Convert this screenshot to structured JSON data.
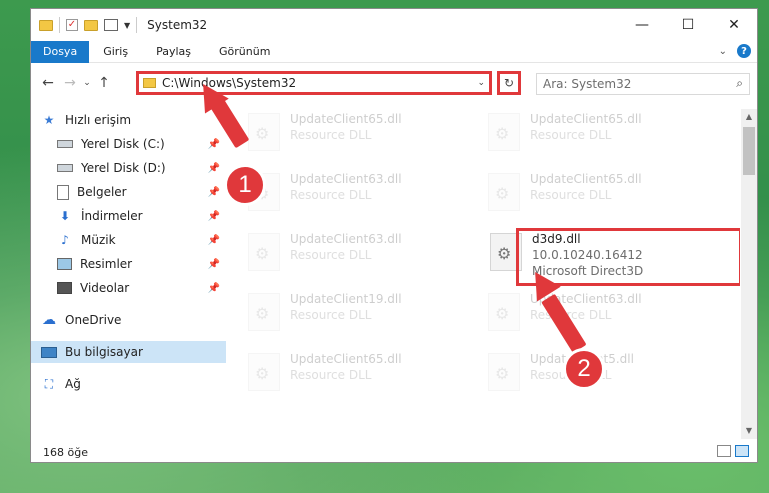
{
  "window": {
    "title": "System32",
    "controls": {
      "minimize": "—",
      "maximize": "☐",
      "close": "✕"
    }
  },
  "ribbon": {
    "tabs": [
      "Dosya",
      "Giriş",
      "Paylaş",
      "Görünüm"
    ],
    "help": "?"
  },
  "navigation": {
    "address_path": "C:\\Windows\\System32",
    "search_placeholder": "Ara: System32"
  },
  "sidebar": {
    "items": [
      {
        "label": "Hızlı erişim",
        "icon": "star-icon"
      },
      {
        "label": "Yerel Disk (C:)",
        "icon": "drive-icon",
        "pinned": true
      },
      {
        "label": "Yerel Disk (D:)",
        "icon": "drive-icon",
        "pinned": true
      },
      {
        "label": "Belgeler",
        "icon": "documents-icon",
        "pinned": true
      },
      {
        "label": "İndirmeler",
        "icon": "download-icon",
        "pinned": true
      },
      {
        "label": "Müzik",
        "icon": "music-icon",
        "pinned": true
      },
      {
        "label": "Resimler",
        "icon": "pictures-icon",
        "pinned": true
      },
      {
        "label": "Videolar",
        "icon": "video-icon",
        "pinned": true
      },
      {
        "label": "OneDrive",
        "icon": "cloud-icon"
      },
      {
        "label": "Bu bilgisayar",
        "icon": "computer-icon",
        "selected": true
      },
      {
        "label": "Ağ",
        "icon": "network-icon"
      }
    ]
  },
  "files": [
    {
      "name": "UpdateClient65.dll",
      "type": "Resource DLL",
      "faded": true
    },
    {
      "name": "UpdateClient65.dll",
      "type": "Resource DLL",
      "faded": true
    },
    {
      "name": "UpdateClient63.dll",
      "type": "Resource DLL",
      "faded": true
    },
    {
      "name": "UpdateClient65.dll",
      "type": "Resource DLL",
      "faded": true
    },
    {
      "name": "UpdateClient63.dll",
      "type": "Resource DLL",
      "faded": true
    },
    {
      "name": "d3d9.dll",
      "version": "10.0.10240.16412",
      "type": "Microsoft Direct3D",
      "faded": false
    },
    {
      "name": "UpdateClient19.dll",
      "type": "Resource DLL",
      "faded": true
    },
    {
      "name": "UpdateClient63.dll",
      "type": "Resource DLL",
      "faded": true
    },
    {
      "name": "UpdateClient65.dll",
      "type": "Resource DLL",
      "faded": true
    },
    {
      "name": "UpdateClient5.dll",
      "type": "Resource DLL",
      "faded": true
    }
  ],
  "status": {
    "item_count": "168 öğe"
  },
  "annotations": {
    "step1": "1",
    "step2": "2"
  },
  "colors": {
    "accent": "#1979ca",
    "highlight": "#e0383b"
  }
}
